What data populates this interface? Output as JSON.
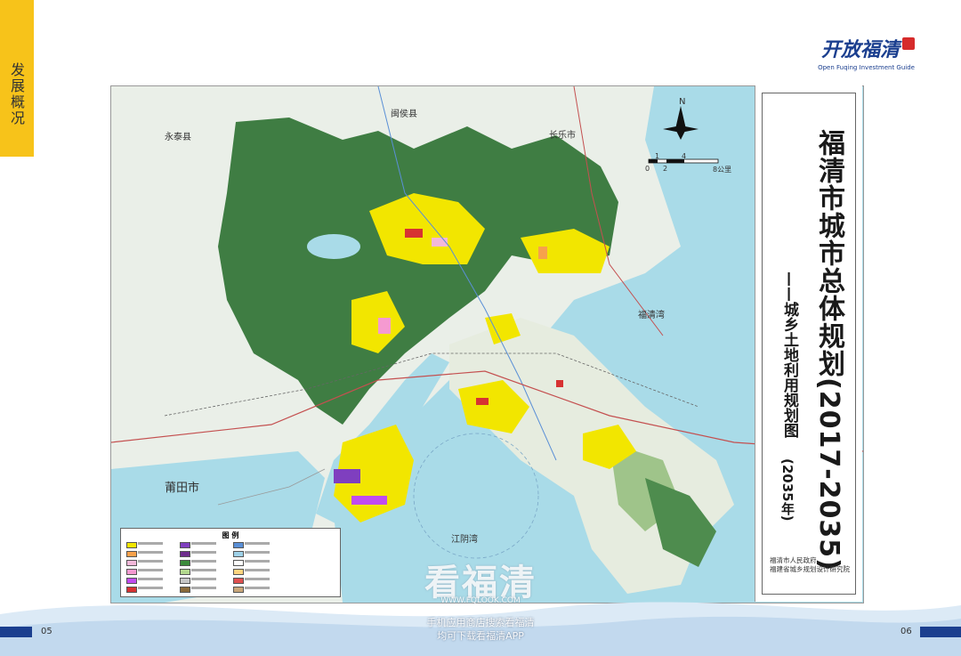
{
  "side_tab": "发展概况",
  "logo": {
    "cn": "开放福清",
    "en": "Open Fuqing Investment Guide"
  },
  "map": {
    "title": "福清市城市总体规划(2017-2035)",
    "subtitle": "——城乡土地利用规划图",
    "year": "(2035年)",
    "credit_1": "福清市人民政府",
    "credit_2": "福建省城乡规划设计研究院",
    "north": "N",
    "scale_labels": [
      "0",
      "1",
      "2",
      "4",
      "8公里"
    ],
    "places": {
      "minhou": "闽侯县",
      "yongtai": "永泰县",
      "changle": "长乐市",
      "putian": "莆田市",
      "fuqing_bay": "福清湾",
      "jiangyin_bay": "江阴湾"
    },
    "legend_title": "图 例",
    "legend_colors": [
      "#f2e600",
      "#f7a14b",
      "#f2b8d9",
      "#f59ad1",
      "#c04cf0",
      "#d73232",
      "#7f3fbf",
      "#6e2b8c",
      "#3b8a3b",
      "#b4d98f",
      "#c7c7c7",
      "#8a6a3a",
      "#5a8fd6",
      "#9ed1e8",
      "#ffffff",
      "#ffd580",
      "#e05050",
      "#c9a77a"
    ]
  },
  "footer": {
    "page_left": "05",
    "page_right": "06",
    "watermark": "看福清",
    "watermark_url": "WWW.FQLOOK.COM",
    "watermark_line1": "手机应用商店搜索看福清",
    "watermark_line2": "均可下载看福清APP"
  }
}
